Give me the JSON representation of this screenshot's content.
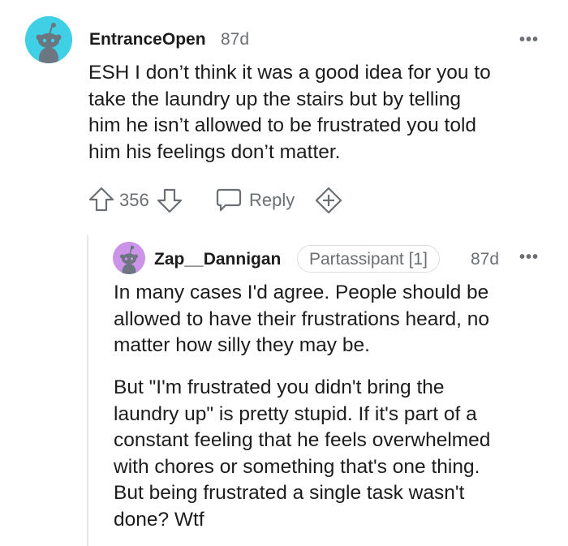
{
  "colors": {
    "avatar1_bg": "#3fd0e6",
    "avatar2_bg": "#cc94e8",
    "meta_gray": "#6b6f73",
    "text_dark": "#1c1c1c"
  },
  "comment": {
    "username": "EntranceOpen",
    "age": "87d",
    "more_icon": "•••",
    "text": "ESH I don’t think it was a good idea for you to\ntake the laundry up the stairs but by telling\nhim he isn’t allowed to be frustrated you told\nhim his feelings don’t matter.",
    "actions": {
      "upvote_icon": "arrow-up-icon",
      "score": "356",
      "downvote_icon": "arrow-down-icon",
      "reply_icon": "chat-bubble-icon",
      "reply_label": "Reply",
      "award_icon": "plus-award-icon"
    }
  },
  "reply": {
    "username": "Zap__Dannigan",
    "flair": "Partassipant [1]",
    "age": "87d",
    "more_icon": "•••",
    "paragraph1": "In many cases I'd agree. People should be\nallowed to have their frustrations heard, no\nmatter how silly they may be.",
    "paragraph2": "But \"I'm frustrated you didn't bring the\nlaundry up\" is pretty stupid. If it's part of a\nconstant feeling that he feels overwhelmed\nwith chores or something that's one thing.\nBut being frustrated a single task wasn't\ndone? Wtf"
  }
}
